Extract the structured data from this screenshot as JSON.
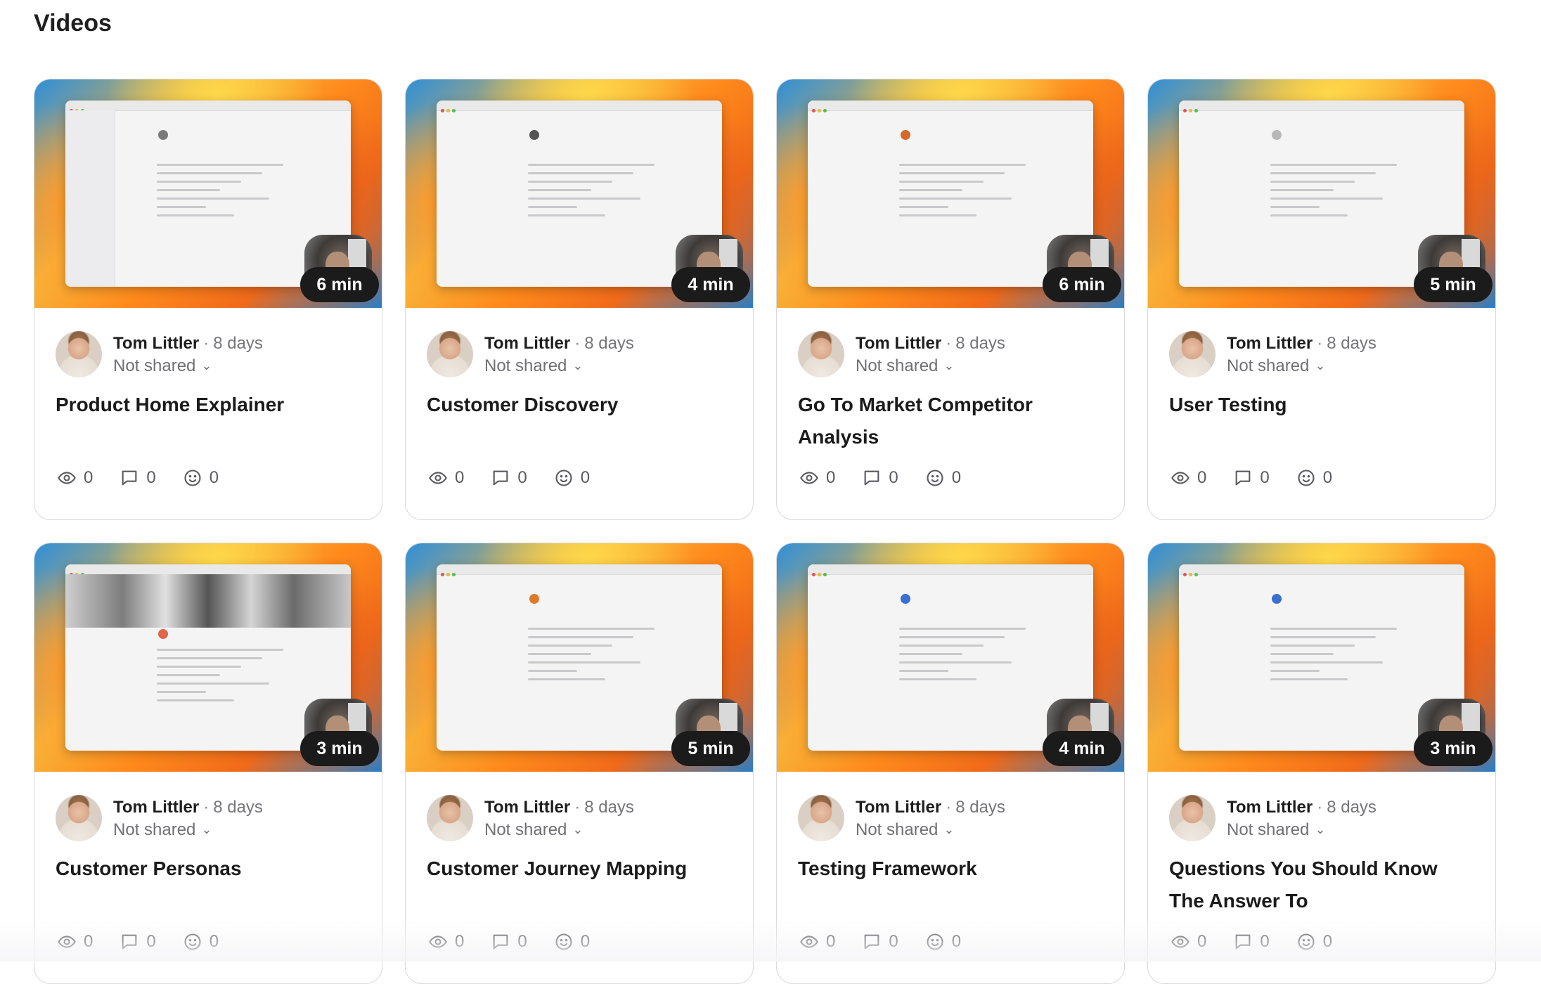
{
  "page": {
    "title": "Videos"
  },
  "videos": [
    {
      "title": "Product Home Explainer",
      "duration": "6 min",
      "author": "Tom Littler",
      "separator": "·",
      "age": "8 days",
      "sharing": "Not shared",
      "views": "0",
      "comments": "0",
      "reactions": "0",
      "thumb_variant": "sidebar",
      "emblem_color": "#7a7a7a"
    },
    {
      "title": "Customer Discovery",
      "duration": "4 min",
      "author": "Tom Littler",
      "separator": "·",
      "age": "8 days",
      "sharing": "Not shared",
      "views": "0",
      "comments": "0",
      "reactions": "0",
      "thumb_variant": "doc",
      "emblem_color": "#555555"
    },
    {
      "title": "Go To Market Competitor Analysis",
      "duration": "6 min",
      "author": "Tom Littler",
      "separator": "·",
      "age": "8 days",
      "sharing": "Not shared",
      "views": "0",
      "comments": "0",
      "reactions": "0",
      "thumb_variant": "doc",
      "emblem_color": "#d46a2a"
    },
    {
      "title": "User Testing",
      "duration": "5 min",
      "author": "Tom Littler",
      "separator": "·",
      "age": "8 days",
      "sharing": "Not shared",
      "views": "0",
      "comments": "0",
      "reactions": "0",
      "thumb_variant": "doc",
      "emblem_color": "#b8b8b8"
    },
    {
      "title": "Customer Personas",
      "duration": "3 min",
      "author": "Tom Littler",
      "separator": "·",
      "age": "8 days",
      "sharing": "Not shared",
      "views": "0",
      "comments": "0",
      "reactions": "0",
      "thumb_variant": "photo",
      "emblem_color": "#e0664a"
    },
    {
      "title": "Customer Journey Mapping",
      "duration": "5 min",
      "author": "Tom Littler",
      "separator": "·",
      "age": "8 days",
      "sharing": "Not shared",
      "views": "0",
      "comments": "0",
      "reactions": "0",
      "thumb_variant": "doc",
      "emblem_color": "#e07a2a"
    },
    {
      "title": "Testing Framework",
      "duration": "4 min",
      "author": "Tom Littler",
      "separator": "·",
      "age": "8 days",
      "sharing": "Not shared",
      "views": "0",
      "comments": "0",
      "reactions": "0",
      "thumb_variant": "doc",
      "emblem_color": "#3a6fd0"
    },
    {
      "title": "Questions You Should Know The Answer To",
      "duration": "3 min",
      "author": "Tom Littler",
      "separator": "·",
      "age": "8 days",
      "sharing": "Not shared",
      "views": "0",
      "comments": "0",
      "reactions": "0",
      "thumb_variant": "doc",
      "emblem_color": "#3a6fd0"
    }
  ],
  "icons": {
    "views": "eye-icon",
    "comments": "comment-icon",
    "reactions": "smiley-icon",
    "sharing": "chevron-down-icon"
  },
  "colors": {
    "duration_badge": "#1b1b1b",
    "card_border": "#d9d9de"
  }
}
